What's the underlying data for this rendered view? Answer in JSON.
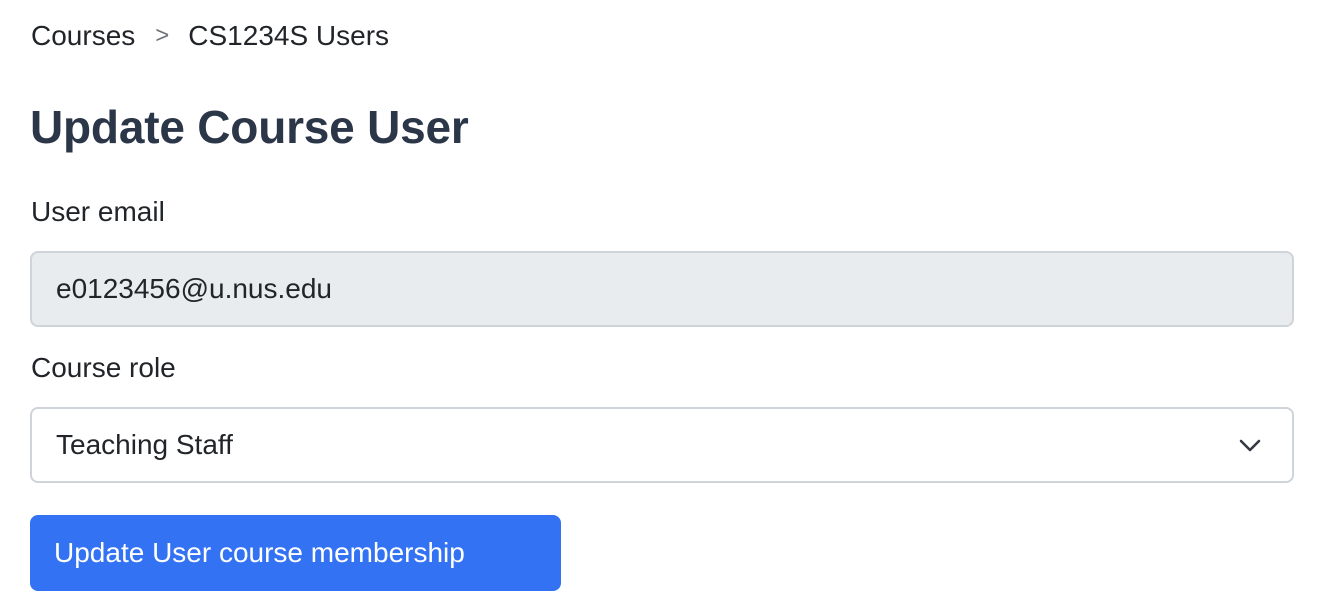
{
  "breadcrumb": {
    "items": [
      {
        "label": "Courses"
      },
      {
        "label": "CS1234S Users"
      }
    ],
    "separator": ">"
  },
  "page": {
    "title": "Update Course User"
  },
  "form": {
    "email": {
      "label": "User email",
      "value": "e0123456@u.nus.edu",
      "readonly": true
    },
    "role": {
      "label": "Course role",
      "selected": "Teaching Staff",
      "icon": "chevron-down-icon"
    },
    "submit_label": "Update User course membership"
  },
  "colors": {
    "primary": "#3272f3",
    "title": "#2b3648",
    "readonly_bg": "#e9ecef",
    "border": "#ced4da"
  }
}
